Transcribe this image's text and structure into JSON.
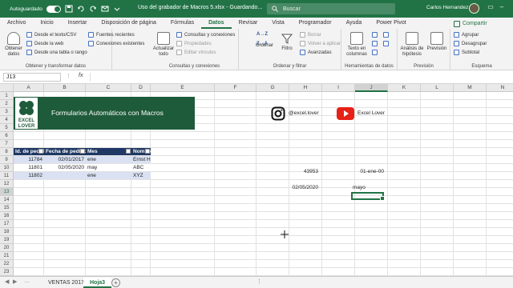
{
  "titlebar": {
    "autosave_label": "Autoguardado",
    "autosave_state": "on",
    "doc_title": "Uso del grabador de Macros 5.xlsx - Guardando...",
    "search_placeholder": "Buscar",
    "user_name": "Carlos Hernandez",
    "brand_color": "#217346"
  },
  "tabs": [
    "Archivo",
    "Inicio",
    "Insertar",
    "Disposición de página",
    "Fórmulas",
    "Datos",
    "Revisar",
    "Vista",
    "Programador",
    "Ayuda",
    "Power Pivot"
  ],
  "active_tab": "Datos",
  "share_label": "Compartir",
  "ribbon": {
    "get_data": {
      "big": "Obtener datos",
      "small": [
        "Desde el texto/CSV",
        "Desde la web",
        "Desde una tabla o rango",
        "Fuentes recientes",
        "Conexiones existentes"
      ],
      "label": "Obtener y transformar datos"
    },
    "queries": {
      "big": "Actualizar todo",
      "small": [
        "Consultas y conexiones",
        "Propiedades",
        "Editar vínculos"
      ],
      "label": "Consultas y conexiones"
    },
    "sort_filter": {
      "sort_az": "A→Z",
      "sort_za": "Z→A",
      "sort": "Ordenar",
      "filter": "Filtro",
      "small": [
        "Borrar",
        "Volver a aplicar",
        "Avanzadas"
      ],
      "label": "Ordenar y filtrar"
    },
    "data_tools": {
      "big": "Texto en columnas",
      "label": "Herramientas de datos"
    },
    "forecast": {
      "whatif": "Análisis de hipótesis",
      "forecast": "Previsión",
      "label": "Previsión"
    },
    "outline": {
      "small": [
        "Agrupar",
        "Desagrupar",
        "Subtotal"
      ],
      "label": "Esquema"
    }
  },
  "formula_bar": {
    "cell_ref": "J13",
    "fx": "fx",
    "content": ""
  },
  "columns": [
    "A",
    "B",
    "C",
    "D",
    "E",
    "F",
    "G",
    "H",
    "I",
    "J",
    "K",
    "L",
    "M",
    "N"
  ],
  "selected_column": "J",
  "rows": [
    "1",
    "2",
    "3",
    "4",
    "5",
    "6",
    "7",
    "8",
    "9",
    "10",
    "11",
    "12",
    "13",
    "14",
    "15",
    "16",
    "17",
    "18",
    "19",
    "20",
    "21",
    "22",
    "23"
  ],
  "selected_row": "13",
  "banner": {
    "title": "Formularios Automáticos con Macros",
    "logo_text_1": "EXCEL",
    "logo_text_2": "LOVER"
  },
  "social": {
    "instagram": "@excel.lover",
    "youtube": "Excel Lover"
  },
  "table": {
    "headers": [
      "Id. de pedido",
      "Fecha de pedido",
      "Mes",
      "Nombre de compañía"
    ],
    "rows": [
      [
        "11784",
        "02/01/2017",
        "ene",
        "Ernst Handel"
      ],
      [
        "11801",
        "02/05/2020",
        "may",
        "ABC"
      ],
      [
        "11802",
        "",
        "ene",
        "XYZ"
      ]
    ]
  },
  "extra_cells": {
    "h10": "43953",
    "j10": "01-ene-00",
    "h12": "02/05/2020",
    "j12": "mayo"
  },
  "sheets": [
    "VENTAS 2017",
    "Hoja3"
  ],
  "active_sheet": "Hoja3"
}
